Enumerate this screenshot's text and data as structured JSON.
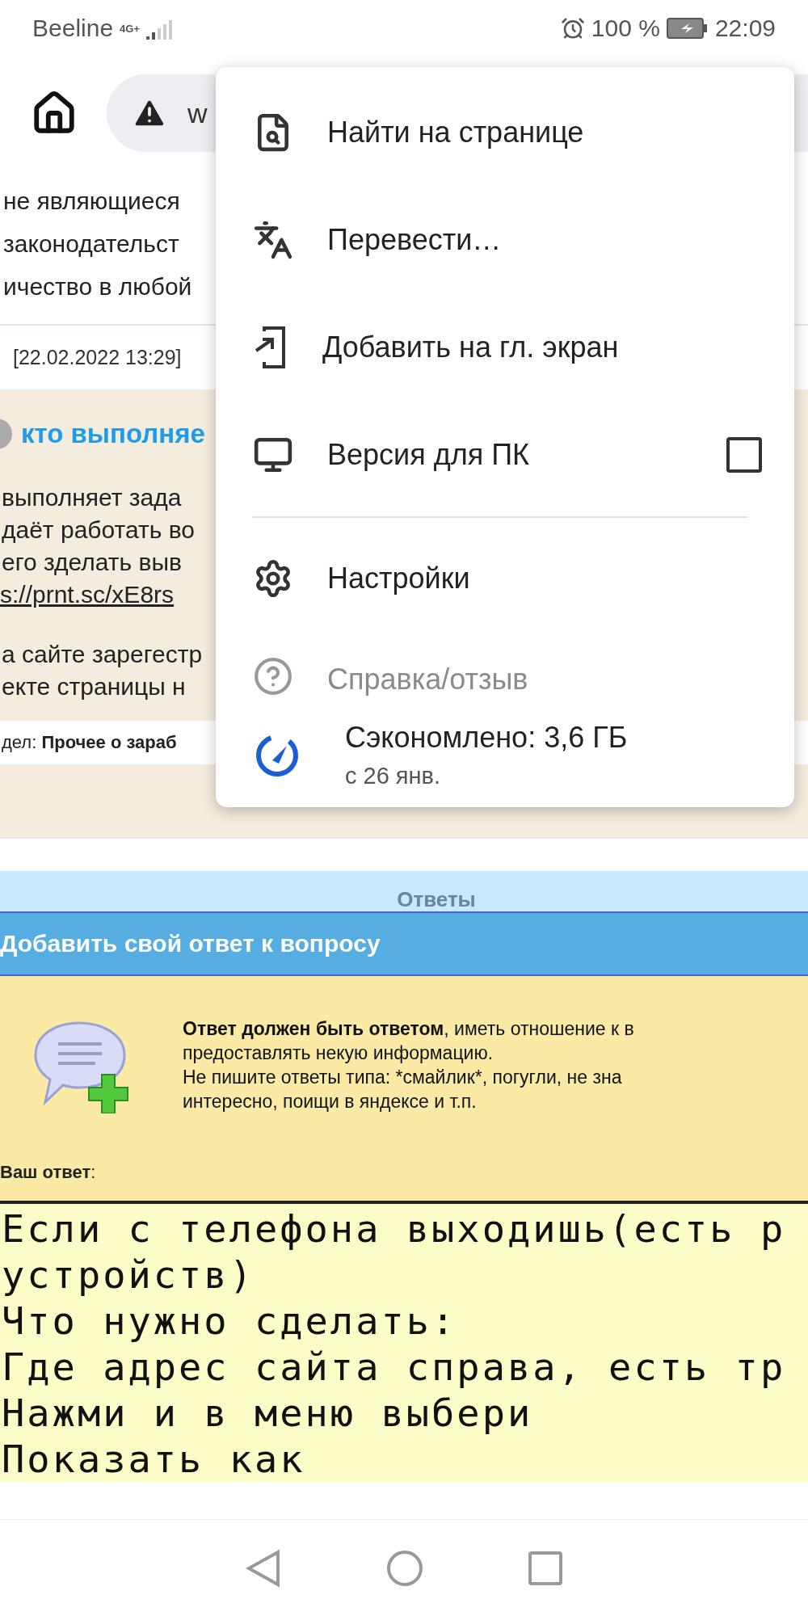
{
  "status_bar": {
    "carrier": "Beeline",
    "network": "4G+",
    "battery": "100 %",
    "time": "22:09"
  },
  "toolbar": {
    "url": "w"
  },
  "page": {
    "intro_lines": [
      "не являющиеся",
      "законодательст",
      "ичество в любой"
    ],
    "date": "[22.02.2022 13:29]",
    "question_title": "кто выполняе",
    "body_lines": [
      "выполняет зада",
      "даёт работать во",
      "его зделать выв"
    ],
    "link": "s://prnt.sc/xE8rs",
    "body_lines_2": [
      "а сайте зарегестр",
      "екте страницы н"
    ],
    "section_label": "дел:",
    "section_value": "Прочее о зараб",
    "answers_header": "Ответы",
    "add_answer": {
      "title": "Добавить свой ответ к вопросу",
      "rules": {
        "bold_lead": "Ответ должен быть ответом",
        "lines": [
          ", иметь отношение к в",
          "предоставлять некую информацию.",
          "Не пишите ответы типа: *смайлик*, погугли, не зна",
          "интересно, поищи в яндексе и т.п."
        ]
      },
      "answer_label": "**Ваш ответ**:",
      "answer_lines": [
        "Если с телефона выходишь(есть р",
        "устройств)",
        "Что нужно сделать:",
        "Где адрес сайта справа, есть тр",
        "Нажми и в меню выбери",
        "Показать как"
      ]
    }
  },
  "menu": {
    "items": [
      {
        "kind": "action",
        "label": "Найти на странице"
      },
      {
        "kind": "action",
        "label": "Перевести…"
      },
      {
        "kind": "action",
        "label": "Добавить на гл. экран"
      },
      {
        "kind": "checkbox",
        "label": "Версия для ПК",
        "checked": false
      },
      {
        "kind": "divider"
      },
      {
        "kind": "action",
        "label": "Настройки"
      },
      {
        "kind": "faded",
        "label": "Справка/отзыв"
      },
      {
        "kind": "savings",
        "label": "Сэкономлено: 3,6 ГБ",
        "sub": "с 26 янв."
      }
    ]
  }
}
